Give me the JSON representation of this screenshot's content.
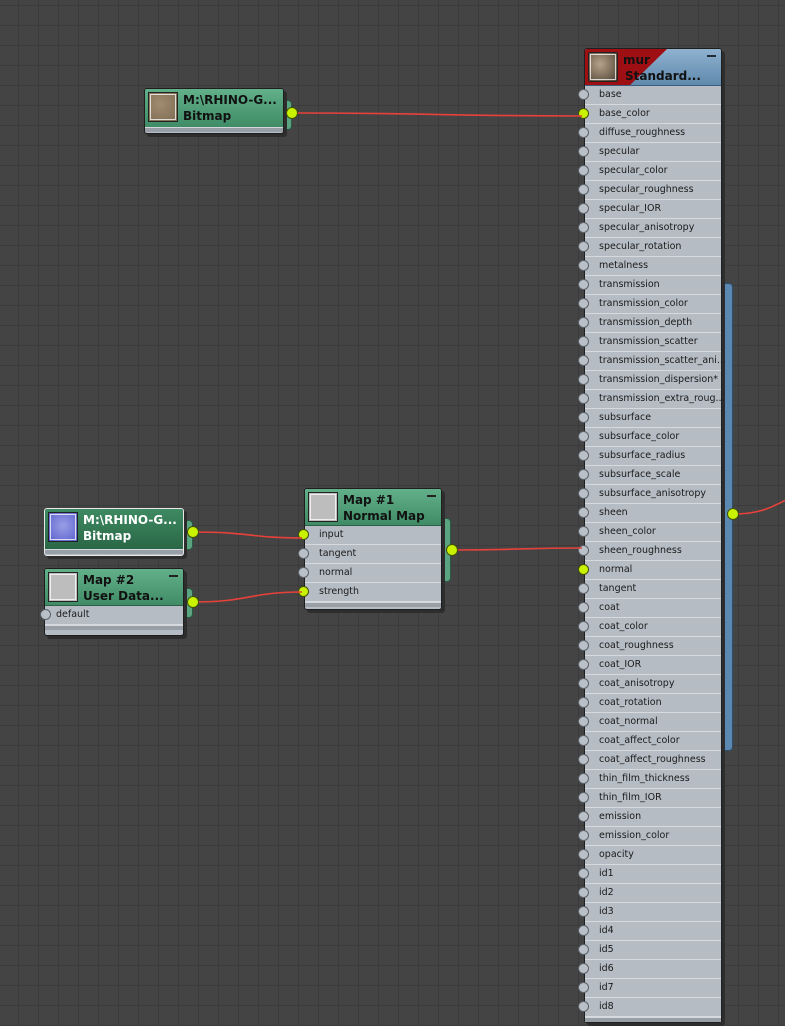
{
  "nodes": {
    "bitmap_top": {
      "title": "M:\\RHINO-G...",
      "subtitle": "Bitmap"
    },
    "bitmap_normal": {
      "title": "M:\\RHINO-G...",
      "subtitle": "Bitmap"
    },
    "user_data": {
      "title": "Map #2",
      "subtitle": "User Data...",
      "inputs": [
        "default"
      ]
    },
    "normal_map": {
      "title": "Map #1",
      "subtitle": "Normal Map",
      "inputs": [
        "input",
        "tangent",
        "normal",
        "strength"
      ]
    },
    "material": {
      "title": "mur",
      "subtitle": "Standard...",
      "inputs": [
        "base",
        "base_color",
        "diffuse_roughness",
        "specular",
        "specular_color",
        "specular_roughness",
        "specular_IOR",
        "specular_anisotropy",
        "specular_rotation",
        "metalness",
        "transmission",
        "transmission_color",
        "transmission_depth",
        "transmission_scatter",
        "transmission_scatter_ani...",
        "transmission_dispersion*",
        "transmission_extra_roug...",
        "subsurface",
        "subsurface_color",
        "subsurface_radius",
        "subsurface_scale",
        "subsurface_anisotropy",
        "sheen",
        "sheen_color",
        "sheen_roughness",
        "normal",
        "tangent",
        "coat",
        "coat_color",
        "coat_roughness",
        "coat_IOR",
        "coat_anisotropy",
        "coat_rotation",
        "coat_normal",
        "coat_affect_color",
        "coat_affect_roughness",
        "thin_film_thickness",
        "thin_film_IOR",
        "emission",
        "emission_color",
        "opacity",
        "id1",
        "id2",
        "id3",
        "id4",
        "id5",
        "id6",
        "id7",
        "id8"
      ],
      "connected": [
        "base_color",
        "normal"
      ]
    }
  },
  "colors": {
    "wire": "#e8413b",
    "socket_connected": "#c8f200",
    "socket_empty": "#b9c0c8",
    "map_header": "#4f9e78",
    "material_header": "#6f97b9"
  }
}
